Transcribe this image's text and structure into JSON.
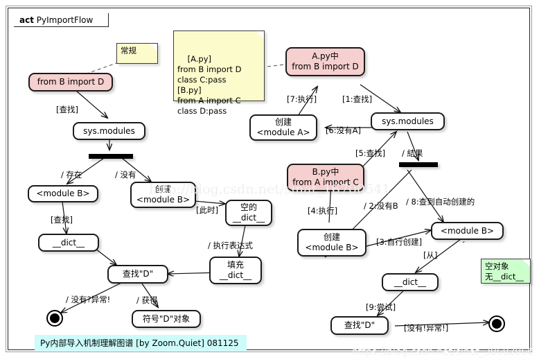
{
  "diagram": {
    "kind_keyword": "act",
    "title": "PyImportFlow",
    "caption": "Py内部导入机制理解图谱 [by Zoom.Quiet] 081125"
  },
  "watermarks": {
    "center": "http://blog.csdn.net/sinat_16700541",
    "bottom": "https://blog.csdn.net/sinat_38682860"
  },
  "notes": {
    "normal": "常规",
    "code": "[A.py]\nfrom B import D\nclass C:pass\n[B.py]\nfrom A import C\nclass D:pass",
    "empty_object_l1": "空对象",
    "empty_object_l2": "无__dict__"
  },
  "nodes": {
    "from_b_import_d": "from B import D",
    "sys_modules_left": "sys.modules",
    "module_b_left": "<module B>",
    "create_module_b_left_l1": "创建",
    "create_module_b_left_l2": "<module B>",
    "dict_left": "__dict__",
    "empty_dict_l1": "空的",
    "empty_dict_l2": "__dict__",
    "fill_dict_l1": "填充",
    "fill_dict_l2": "__dict__",
    "find_d_left": "查找\"D\"",
    "symbol_d_object": "符号\"D\"对象",
    "apy_l1": "A.py中",
    "apy_l2": "from B import D",
    "create_module_a_l1": "创建",
    "create_module_a_l2": "<module A>",
    "sys_modules_right": "sys.modules",
    "bpy_l1": "B.py中",
    "bpy_l2": "from A import C",
    "create_module_b_right_l1": "创建",
    "create_module_b_right_l2": "<module B>",
    "module_b_right": "<module B>",
    "dict_right": "__dict__",
    "find_d_right": "查找\"D\""
  },
  "edge_labels": {
    "find_left": "[查找]",
    "exists": "/ 存在",
    "none": "/ 没有",
    "find_dict_left": "[查找]",
    "at_this_time": "[此时]",
    "eval_expression": "/ 执行表达式",
    "no_exception": "/ 没有?异常!",
    "obtain": "/ 获得",
    "s7_exec": "[7:执行]",
    "s1_find": "[1:查找]",
    "s6_no_a": "[6:没有A]",
    "s5_find": "[5:查找]",
    "result": "/ 結果",
    "s4_exec": "[4:执行]",
    "s2_no_b": "/ 2:没有B",
    "s8_found_auto": "/ 8:查到自动创建的",
    "s3_self_create": "[3:自行创建]",
    "from": "[从]",
    "s9_try": "[9:尝试]",
    "none_exception": "[没有!异常!]"
  },
  "colors": {
    "pink_node": "#f6cfcf",
    "yellow_note": "#fbfbcc",
    "green_note": "#ccffcc",
    "caption_bg": "#ccfbfb",
    "stroke": "#1a1a1a"
  }
}
